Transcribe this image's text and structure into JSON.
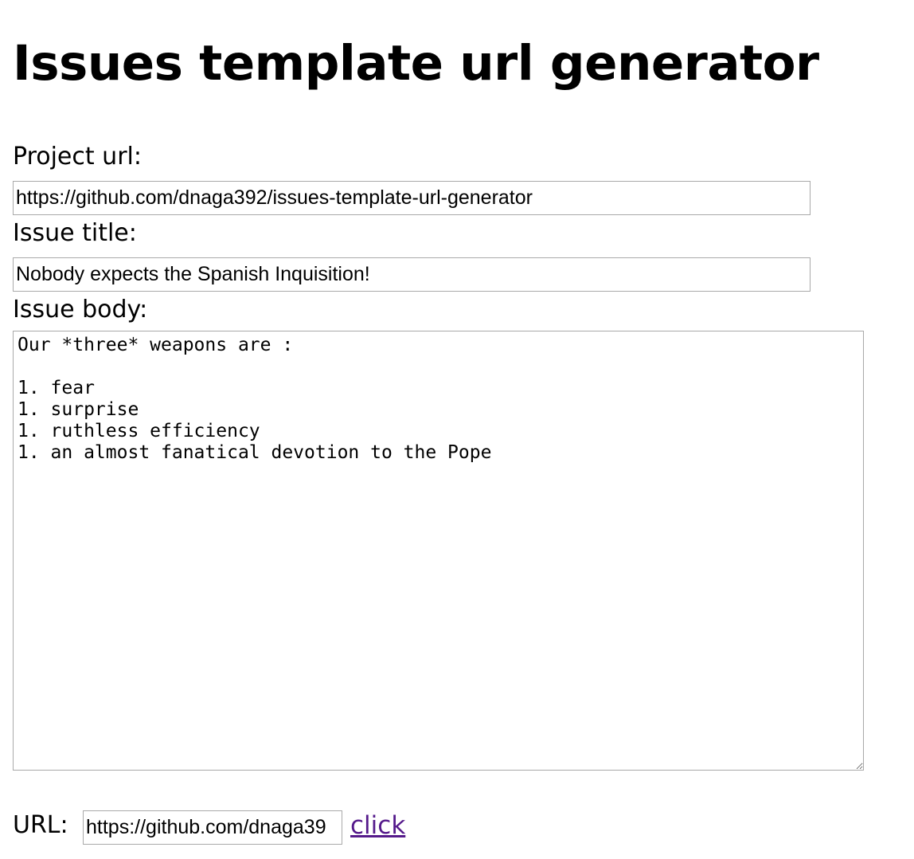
{
  "page": {
    "title": "Issues template url generator"
  },
  "form": {
    "project_url": {
      "label": "Project url:",
      "value": "https://github.com/dnaga392/issues-template-url-generator"
    },
    "issue_title": {
      "label": "Issue title:",
      "value": "Nobody expects the Spanish Inquisition!"
    },
    "issue_body": {
      "label": "Issue body:",
      "value": "Our *three* weapons are :\n\n1. fear\n1. surprise\n1. ruthless efficiency\n1. an almost fanatical devotion to the Pope"
    }
  },
  "result": {
    "label": "URL:",
    "value": "https://github.com/dnaga39",
    "link_text": "click"
  },
  "colors": {
    "link": "#551a8b",
    "input_border": "#a9a9a9"
  }
}
